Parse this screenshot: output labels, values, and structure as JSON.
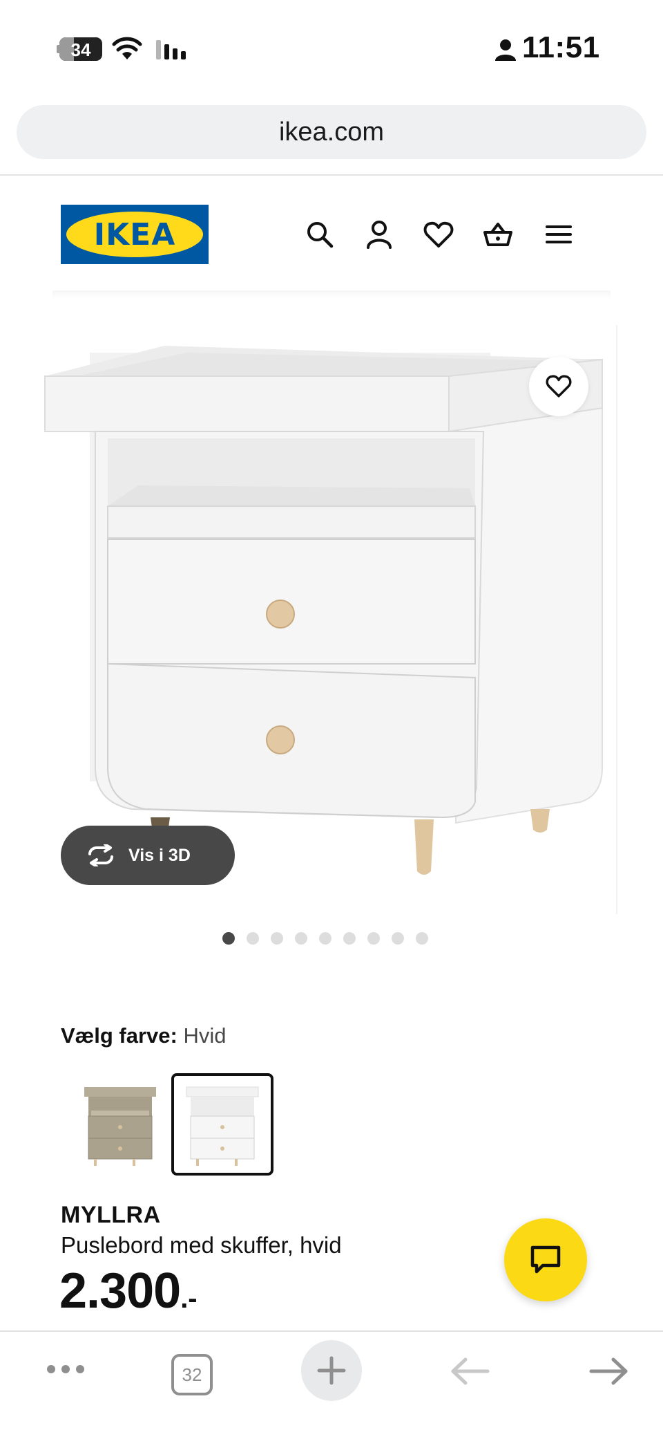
{
  "status_bar": {
    "battery_level": "34",
    "time": "11:51",
    "icons": [
      "battery-icon",
      "wifi-icon",
      "signal-icon",
      "person-icon"
    ]
  },
  "browser": {
    "url": "ikea.com",
    "tab_count": "32"
  },
  "header": {
    "logo_text": "IKEA",
    "icons": [
      "search-icon",
      "account-icon",
      "heart-icon",
      "basket-icon",
      "menu-icon"
    ]
  },
  "gallery": {
    "view_3d_label": "Vis i 3D",
    "image_count": 9,
    "active_index": 0
  },
  "color_selector": {
    "label": "Vælg farve:",
    "selected": "Hvid",
    "options": [
      "grey-beige",
      "white"
    ]
  },
  "product": {
    "name": "MYLLRA",
    "description": "Puslebord med skuffer, hvid",
    "price": "2.300",
    "price_suffix": ".-"
  },
  "colors": {
    "ikea_blue": "#0058a3",
    "ikea_yellow": "#ffda1a",
    "chat_yellow": "#fbd914",
    "dark_pill": "#484848"
  }
}
